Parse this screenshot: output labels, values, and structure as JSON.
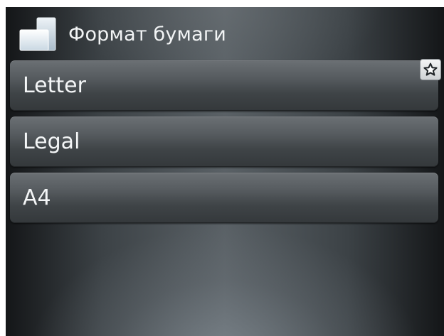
{
  "header": {
    "title": "Формат бумаги",
    "icon": "paper-size-icon"
  },
  "list": {
    "items": [
      {
        "label": "Letter",
        "favorite": true,
        "favorite_icon": "star-icon"
      },
      {
        "label": "Legal"
      },
      {
        "label": "A4"
      }
    ]
  },
  "colors": {
    "text": "#f4f6f7",
    "item_top": "#6b7074",
    "item_bottom": "#34383b",
    "background_center": "#5a6166",
    "background_edge": "#141618"
  }
}
